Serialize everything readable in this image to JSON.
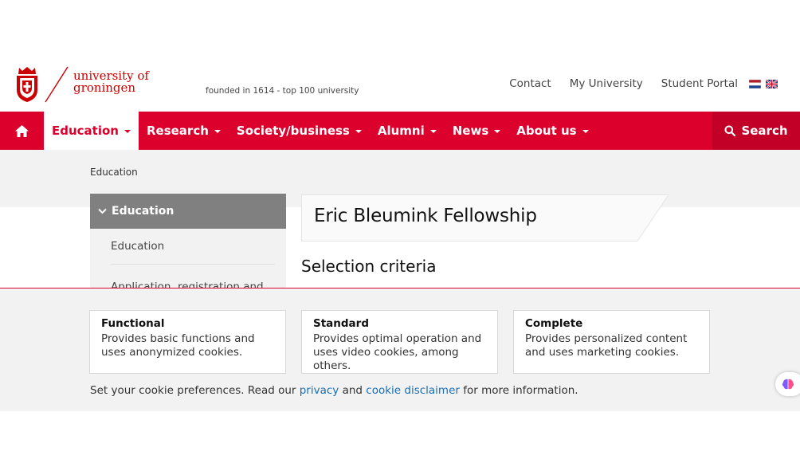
{
  "header": {
    "logo_line1": "university of",
    "logo_line2": "groningen",
    "tagline": "founded in 1614  -  top 100 university",
    "links": [
      "Contact",
      "My University",
      "Student Portal"
    ],
    "flags": [
      "nl-flag-icon",
      "uk-flag-icon"
    ]
  },
  "nav": {
    "home_icon": "home-icon",
    "items": [
      "Education",
      "Research",
      "Society/business",
      "Alumni",
      "News",
      "About us"
    ],
    "active": "Education",
    "search_label": "Search",
    "colors": {
      "brand": "#dc002d",
      "search_bg": "#c20027"
    }
  },
  "breadcrumb": {
    "current": "Education"
  },
  "sidebar": {
    "heading": "Education",
    "items": [
      "Education",
      "Application, registration and"
    ]
  },
  "main": {
    "title": "Eric Bleumink Fellowship",
    "section_heading": "Selection criteria"
  },
  "cookie": {
    "cards": [
      {
        "title": "Functional",
        "desc": "Provides basic functions and uses anonymized cookies."
      },
      {
        "title": "Standard",
        "desc": "Provides optimal operation and uses video cookies, among others."
      },
      {
        "title": "Complete",
        "desc": "Provides personalized content and uses marketing cookies."
      }
    ],
    "note_pre": "Set your cookie preferences. Read our ",
    "privacy_link": "privacy",
    "note_mid": " and ",
    "disclaimer_link": "cookie disclaimer",
    "note_post": " for more information.",
    "link_color": "#1a6fb5"
  }
}
